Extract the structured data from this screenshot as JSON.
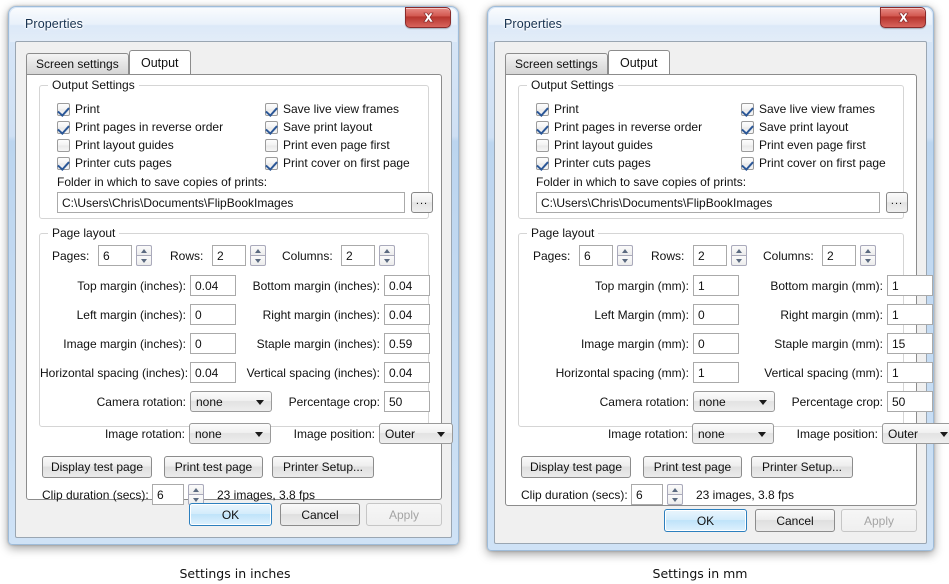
{
  "captions": {
    "left": "Settings in inches",
    "right": "Settings in mm"
  },
  "dialogs": [
    {
      "title": "Properties",
      "close_icon": "close-x-icon",
      "tabs": [
        {
          "label": "Screen settings",
          "active": false
        },
        {
          "label": "Output",
          "active": true
        }
      ],
      "output_settings": {
        "legend": "Output Settings",
        "checkboxes_left": [
          {
            "label": "Print",
            "checked": true
          },
          {
            "label": "Print pages in reverse order",
            "checked": true
          },
          {
            "label": "Print layout guides",
            "checked": false
          },
          {
            "label": "Printer cuts pages",
            "checked": true
          }
        ],
        "checkboxes_right": [
          {
            "label": "Save live view frames",
            "checked": true
          },
          {
            "label": "Save print layout",
            "checked": true
          },
          {
            "label": "Print even page first",
            "checked": false
          },
          {
            "label": "Print cover on first page",
            "checked": true
          }
        ],
        "folder_label": "Folder in which to save copies of prints:",
        "folder_value": "C:\\Users\\Chris\\Documents\\FlipBookImages",
        "browse_label": "..."
      },
      "page_layout": {
        "legend": "Page layout",
        "pages_label": "Pages:",
        "pages_value": "6",
        "rows_label": "Rows:",
        "rows_value": "2",
        "columns_label": "Columns:",
        "columns_value": "2",
        "top_margin_label": "Top margin (inches):",
        "top_margin_value": "0.04",
        "bottom_margin_label": "Bottom margin (inches):",
        "bottom_margin_value": "0.04",
        "left_margin_label": "Left margin (inches):",
        "left_margin_value": "0",
        "right_margin_label": "Right margin (inches):",
        "right_margin_value": "0.04",
        "image_margin_label": "Image margin (inches):",
        "image_margin_value": "0",
        "staple_margin_label": "Staple margin (inches):",
        "staple_margin_value": "0.59",
        "h_spacing_label": "Horizontal spacing (inches):",
        "h_spacing_value": "0.04",
        "v_spacing_label": "Vertical spacing (inches):",
        "v_spacing_value": "0.04",
        "camera_rotation_label": "Camera rotation:",
        "camera_rotation_value": "none",
        "percentage_crop_label": "Percentage crop:",
        "percentage_crop_value": "50",
        "image_rotation_label": "Image rotation:",
        "image_rotation_value": "none",
        "image_position_label": "Image position:",
        "image_position_value": "Outer"
      },
      "actions": {
        "display_test_page": "Display test page",
        "print_test_page": "Print test page",
        "printer_setup": "Printer Setup...",
        "clip_duration_label": "Clip duration (secs):",
        "clip_duration_value": "6",
        "clip_info": "23 images, 3.8 fps"
      },
      "footer": {
        "ok": "OK",
        "cancel": "Cancel",
        "apply": "Apply"
      }
    },
    {
      "title": "Properties",
      "close_icon": "close-x-icon",
      "tabs": [
        {
          "label": "Screen settings",
          "active": false
        },
        {
          "label": "Output",
          "active": true
        }
      ],
      "output_settings": {
        "legend": "Output Settings",
        "checkboxes_left": [
          {
            "label": "Print",
            "checked": true
          },
          {
            "label": "Print pages in reverse order",
            "checked": true
          },
          {
            "label": "Print layout guides",
            "checked": false
          },
          {
            "label": "Printer cuts pages",
            "checked": true
          }
        ],
        "checkboxes_right": [
          {
            "label": "Save live view frames",
            "checked": true
          },
          {
            "label": "Save print layout",
            "checked": true
          },
          {
            "label": "Print even page first",
            "checked": false
          },
          {
            "label": "Print cover on first page",
            "checked": true
          }
        ],
        "folder_label": "Folder in which to save copies of prints:",
        "folder_value": "C:\\Users\\Chris\\Documents\\FlipBookImages",
        "browse_label": "..."
      },
      "page_layout": {
        "legend": "Page layout",
        "pages_label": "Pages:",
        "pages_value": "6",
        "rows_label": "Rows:",
        "rows_value": "2",
        "columns_label": "Columns:",
        "columns_value": "2",
        "top_margin_label": "Top margin (mm):",
        "top_margin_value": "1",
        "bottom_margin_label": "Bottom margin (mm):",
        "bottom_margin_value": "1",
        "left_margin_label": "Left Margin (mm):",
        "left_margin_value": "0",
        "right_margin_label": "Right margin (mm):",
        "right_margin_value": "1",
        "image_margin_label": "Image margin (mm):",
        "image_margin_value": "0",
        "staple_margin_label": "Staple margin (mm):",
        "staple_margin_value": "15",
        "h_spacing_label": "Horizontal spacing (mm):",
        "h_spacing_value": "1",
        "v_spacing_label": "Vertical spacing (mm):",
        "v_spacing_value": "1",
        "camera_rotation_label": "Camera rotation:",
        "camera_rotation_value": "none",
        "percentage_crop_label": "Percentage crop:",
        "percentage_crop_value": "50",
        "image_rotation_label": "Image rotation:",
        "image_rotation_value": "none",
        "image_position_label": "Image position:",
        "image_position_value": "Outer"
      },
      "actions": {
        "display_test_page": "Display test page",
        "print_test_page": "Print test page",
        "printer_setup": "Printer Setup...",
        "clip_duration_label": "Clip duration (secs):",
        "clip_duration_value": "6",
        "clip_info": "23 images, 3.8 fps"
      },
      "footer": {
        "ok": "OK",
        "cancel": "Cancel",
        "apply": "Apply"
      }
    }
  ]
}
